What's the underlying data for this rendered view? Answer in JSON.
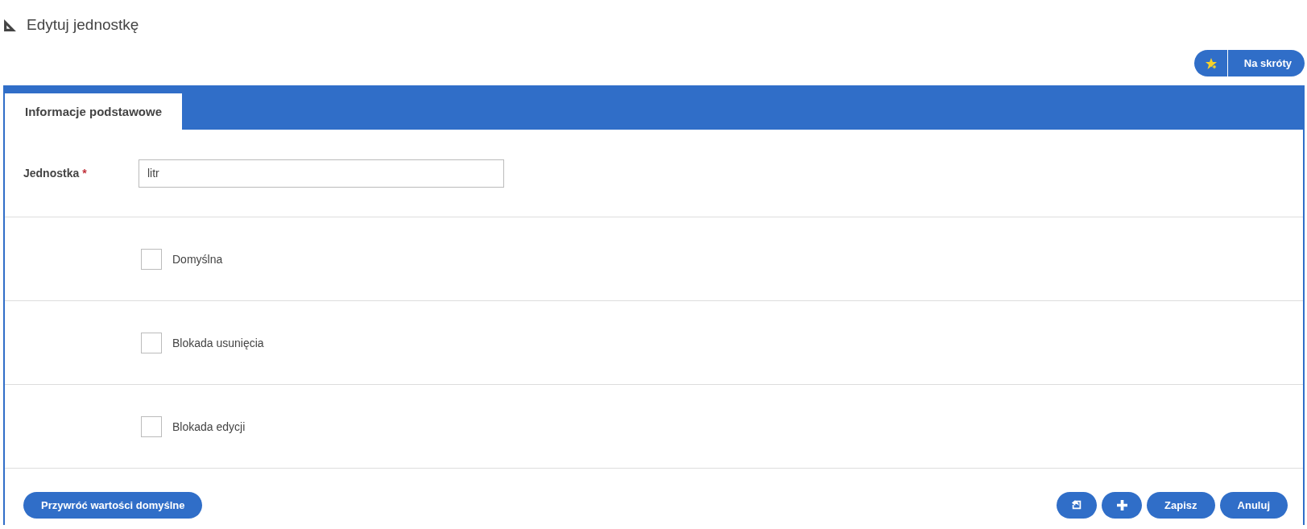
{
  "title": "Edytuj jednostkę",
  "shortcut_button": {
    "label": "Na skróty"
  },
  "tabs": [
    {
      "label": "Informacje podstawowe",
      "selected": true
    }
  ],
  "unit_field": {
    "label": "Jednostka",
    "required_mark": "*",
    "value": "litr"
  },
  "checkboxes": [
    {
      "label": "Domyślna",
      "checked": false
    },
    {
      "label": "Blokada usunięcia",
      "checked": false
    },
    {
      "label": "Blokada edycji",
      "checked": false
    }
  ],
  "reset_button": {
    "label": "Przywróć wartości domyślne"
  },
  "action_buttons": [
    {
      "kind": "back-icon"
    },
    {
      "kind": "plus-icon"
    },
    {
      "kind": "text",
      "label": "Zapisz"
    },
    {
      "kind": "text",
      "label": "Anuluj"
    }
  ]
}
